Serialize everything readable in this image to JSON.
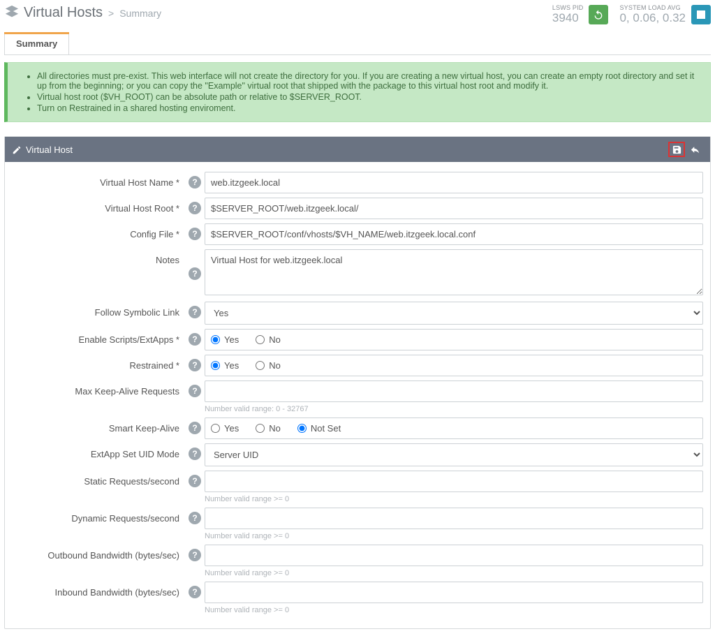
{
  "header": {
    "title": "Virtual Hosts",
    "subtitle": "Summary",
    "lsws_pid_label": "LSWS PID",
    "lsws_pid_value": "3940",
    "load_label": "SYSTEM LOAD AVG",
    "load_value": "0, 0.06, 0.32"
  },
  "tabs": {
    "summary": "Summary"
  },
  "alert": {
    "item1": "All directories must pre-exist. This web interface will not create the directory for you. If you are creating a new virtual host, you can create an empty root directory and set it up from the beginning; or you can copy the \"Example\" virtual root that shipped with the package to this virtual host root and modify it.",
    "item2": "Virtual host root ($VH_ROOT) can be absolute path or relative to $SERVER_ROOT.",
    "item3": "Turn on Restrained in a shared hosting enviroment."
  },
  "panel": {
    "title": "Virtual Host"
  },
  "labels": {
    "name": "Virtual Host Name *",
    "root": "Virtual Host Root *",
    "config": "Config File *",
    "notes": "Notes",
    "symlink": "Follow Symbolic Link",
    "scripts": "Enable Scripts/ExtApps *",
    "restrained": "Restrained *",
    "maxka": "Max Keep-Alive Requests",
    "smartka": "Smart Keep-Alive",
    "uidmode": "ExtApp Set UID Mode",
    "static": "Static Requests/second",
    "dynamic": "Dynamic Requests/second",
    "outbw": "Outbound Bandwidth (bytes/sec)",
    "inbw": "Inbound Bandwidth (bytes/sec)"
  },
  "values": {
    "name": "web.itzgeek.local",
    "root": "$SERVER_ROOT/web.itzgeek.local/",
    "config": "$SERVER_ROOT/conf/vhosts/$VH_NAME/web.itzgeek.local.conf",
    "notes": "Virtual Host for web.itzgeek.local",
    "symlink": "Yes",
    "uidmode": "Server UID",
    "maxka": "",
    "static": "",
    "dynamic": "",
    "outbw": "",
    "inbw": ""
  },
  "hints": {
    "maxka": "Number valid range: 0 - 32767",
    "ge0": "Number valid range >= 0"
  },
  "radio": {
    "yes": "Yes",
    "no": "No",
    "notset": "Not Set"
  }
}
